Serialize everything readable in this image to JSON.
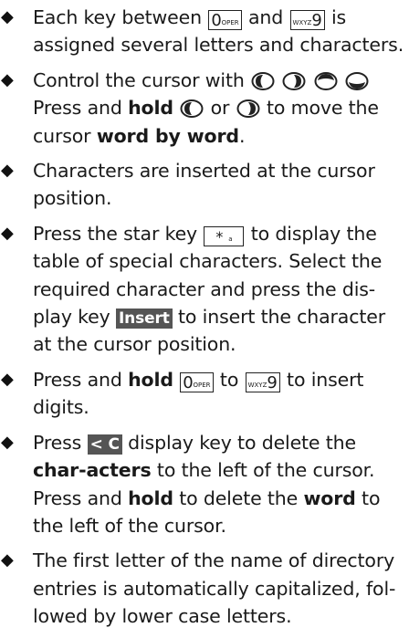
{
  "keys": {
    "zero": {
      "main": "0",
      "sub": "OPER"
    },
    "nine": {
      "main": "9",
      "sub": "WXYZ"
    },
    "star": {
      "main": "*",
      "sub": "a"
    }
  },
  "display_keys": {
    "insert": "Insert",
    "clear": "< C"
  },
  "items": [
    {
      "a": "Each key between ",
      "b": " and ",
      "c": " is assigned several letters and characters."
    },
    {
      "a": "Control the cursor with ",
      "b": " Press and ",
      "bold1": "hold",
      "c": " ",
      "d": " or ",
      "e": " to move the cursor ",
      "bold2": "word by word",
      "f": "."
    },
    {
      "a": "Characters are inserted at the cursor position."
    },
    {
      "a": "Press the star key ",
      "b": " to display the table of special characters. Select the required character and press the dis-play key ",
      "c": " to insert the character at the cursor position."
    },
    {
      "a": "Press and ",
      "bold1": "hold",
      "b": " ",
      "c": " to ",
      "d": " to insert digits."
    },
    {
      "a": "Press ",
      "b": " display key to delete the ",
      "bold1": "char-acters",
      "c": " to the left of the cursor. Press and ",
      "bold2": "hold",
      "d": " to delete the ",
      "bold3": "word",
      "e": " to the left of the cursor."
    },
    {
      "a": "The first letter of the name of directory entries is automatically capitalized, fol-lowed by lower case letters."
    }
  ]
}
